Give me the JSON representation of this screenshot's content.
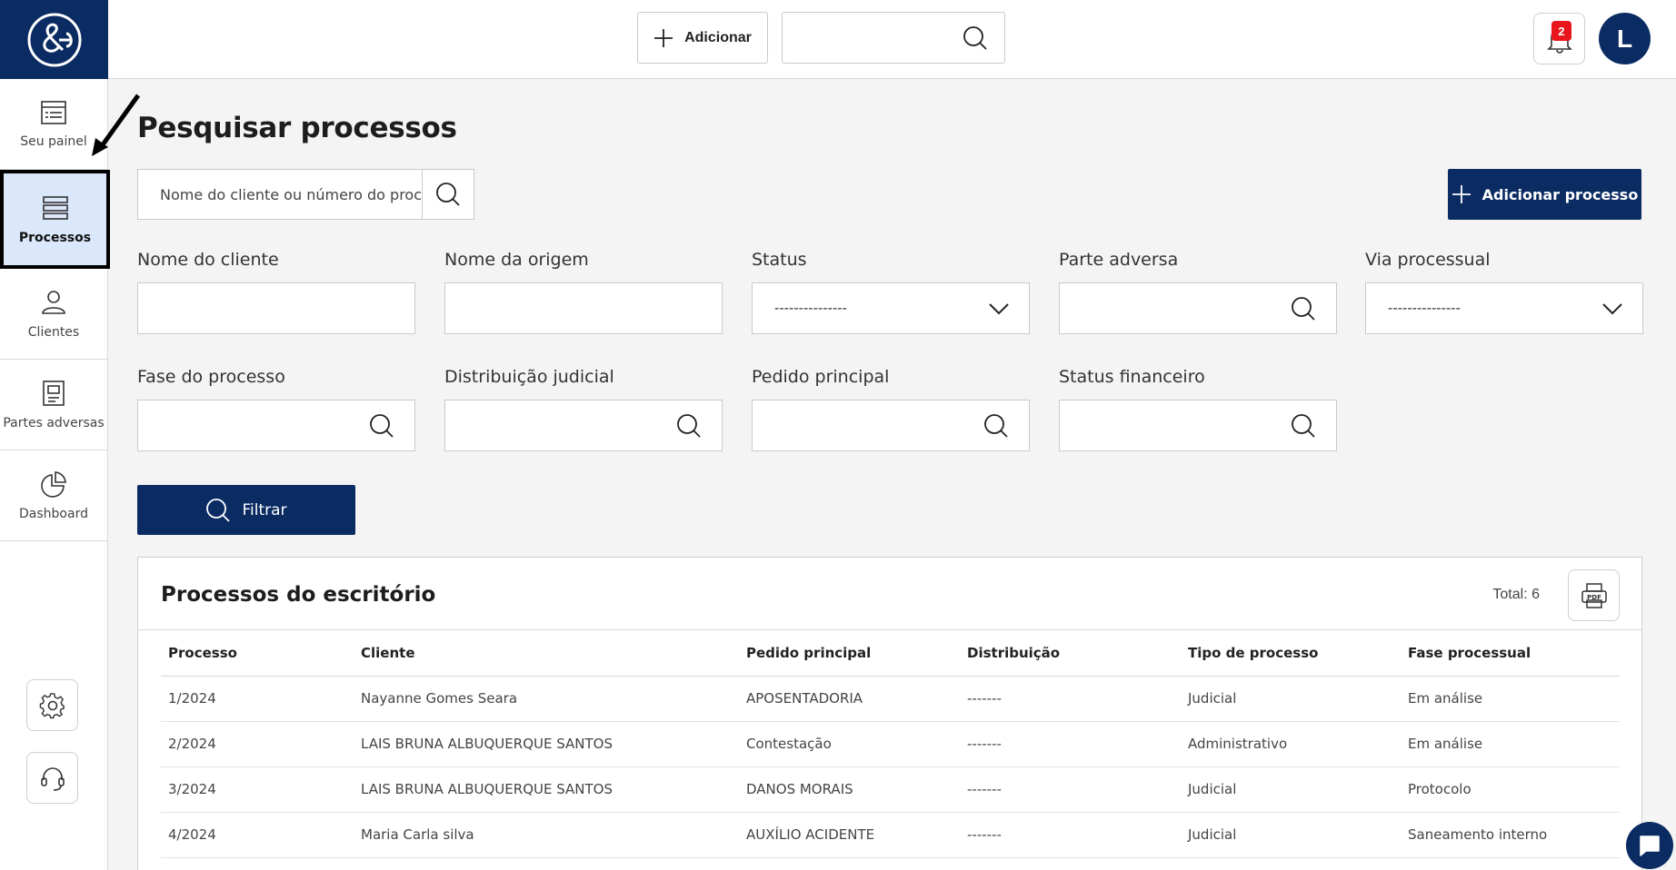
{
  "nav": {
    "items": [
      {
        "label": "Seu painel",
        "icon": "dashboard-list-icon"
      },
      {
        "label": "Processos",
        "icon": "stack-icon",
        "active": true
      },
      {
        "label": "Clientes",
        "icon": "user-icon"
      },
      {
        "label": "Partes adversas",
        "icon": "document-icon"
      },
      {
        "label": "Dashboard",
        "icon": "pie-chart-icon"
      }
    ],
    "settings_icon": "gear-icon",
    "support_icon": "headset-icon"
  },
  "topbar": {
    "add_label": "Adicionar",
    "notifications_count": "2",
    "avatar_initial": "L"
  },
  "page": {
    "title": "Pesquisar processos",
    "search_placeholder": "Nome do cliente ou número do processo",
    "add_process_label": "Adicionar processo"
  },
  "filters": {
    "cliente": {
      "label": "Nome do cliente"
    },
    "origem": {
      "label": "Nome da origem"
    },
    "status": {
      "label": "Status",
      "value": "---------------"
    },
    "parte": {
      "label": "Parte adversa"
    },
    "via": {
      "label": "Via processual",
      "value": "---------------"
    },
    "fase": {
      "label": "Fase do processo"
    },
    "distribuicao": {
      "label": "Distribuição judicial"
    },
    "pedido": {
      "label": "Pedido principal"
    },
    "status_fin": {
      "label": "Status financeiro"
    },
    "filter_label": "Filtrar"
  },
  "table": {
    "title": "Processos do escritório",
    "total": "Total: 6",
    "columns": [
      "Processo",
      "Cliente",
      "Pedido principal",
      "Distribuição",
      "Tipo de processo",
      "Fase processual"
    ],
    "rows": [
      [
        "1/2024",
        "Nayanne Gomes Seara",
        "APOSENTADORIA",
        "-------",
        "Judicial",
        "Em análise"
      ],
      [
        "2/2024",
        "LAIS BRUNA ALBUQUERQUE SANTOS",
        "Contestação",
        "-------",
        "Administrativo",
        "Em análise"
      ],
      [
        "3/2024",
        "LAIS BRUNA ALBUQUERQUE SANTOS",
        "DANOS MORAIS",
        "-------",
        "Judicial",
        "Protocolo"
      ],
      [
        "4/2024",
        "Maria Carla silva",
        "AUXÍLIO ACIDENTE",
        "-------",
        "Judicial",
        "Saneamento interno"
      ]
    ]
  },
  "colors": {
    "primary": "#0b2b63",
    "active_nav": "#dbe7fb",
    "badge": "#e8161c"
  }
}
